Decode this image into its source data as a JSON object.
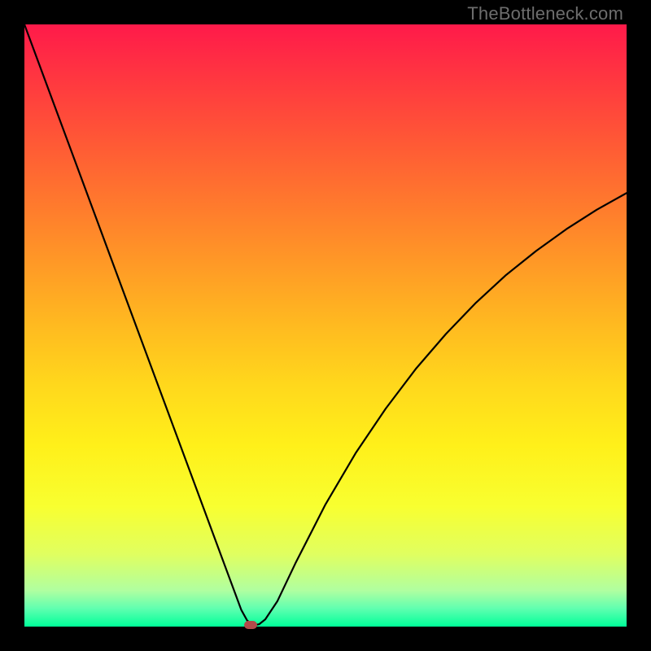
{
  "watermark": "TheBottleneck.com",
  "chart_data": {
    "type": "line",
    "title": "",
    "xlabel": "",
    "ylabel": "",
    "xlim": [
      0,
      100
    ],
    "ylim": [
      0,
      100
    ],
    "series": [
      {
        "name": "curve",
        "x": [
          0,
          5,
          10,
          15,
          20,
          25,
          30,
          33,
          35,
          36,
          37,
          38,
          39,
          40,
          42,
          45,
          50,
          55,
          60,
          65,
          70,
          75,
          80,
          85,
          90,
          95,
          100
        ],
        "y": [
          100,
          86.5,
          73,
          59.5,
          46,
          32.5,
          19,
          10.9,
          5.5,
          2.8,
          1.0,
          0.2,
          0.4,
          1.2,
          4.2,
          10.5,
          20.3,
          28.8,
          36.2,
          42.8,
          48.6,
          53.8,
          58.4,
          62.4,
          66.0,
          69.2,
          72.0
        ]
      }
    ],
    "minimum_point": {
      "x": 37.5,
      "y": 0
    },
    "background_gradient": {
      "top": "#ff1a4a",
      "bottom": "#00ff99"
    }
  }
}
